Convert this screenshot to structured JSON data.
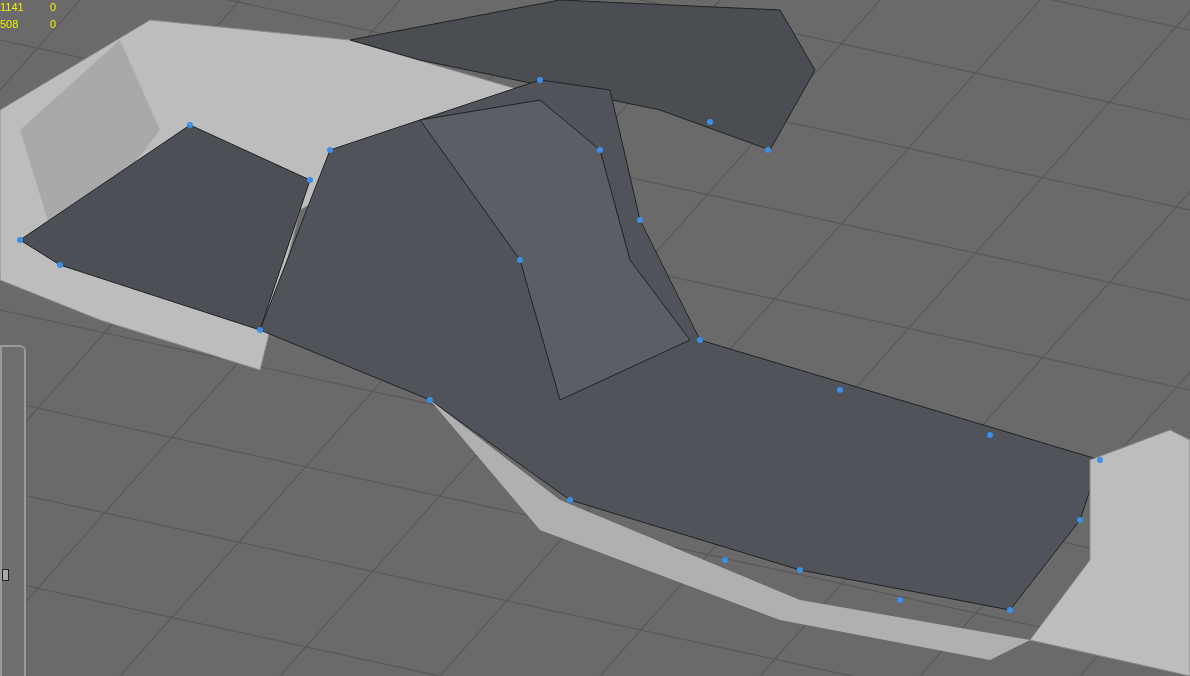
{
  "viewport": {
    "stats": [
      {
        "count": "1141",
        "value": "0"
      },
      {
        "count": "508",
        "value": "0"
      }
    ]
  }
}
